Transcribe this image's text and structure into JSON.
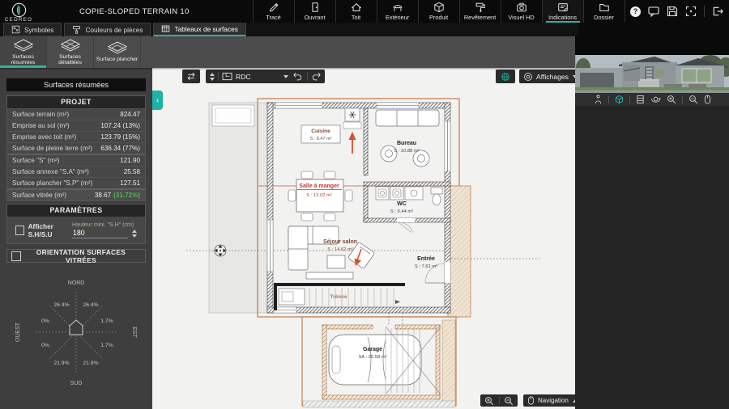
{
  "app": {
    "brand": "CEDREO",
    "title": "COPIE-SLOPED TERRAIN 10",
    "help_glyph": "?",
    "menu": [
      "Tracé",
      "Ouvrant",
      "Toit",
      "Extérieur",
      "Produit",
      "Revêtement",
      "Visuel HD",
      "Indications",
      "Dossier"
    ],
    "active_menu": "Indications"
  },
  "ribbon": {
    "tabs": [
      "Symboles",
      "Couleurs de pièces",
      "Tableaux de surfaces"
    ],
    "active_tab": "Tableaux de surfaces",
    "subtabs": [
      "Surfaces résumées",
      "Surfaces détaillées",
      "Surface plancher"
    ],
    "active_subtab": "Surfaces résumées"
  },
  "sidebar": {
    "title": "Surfaces résumées",
    "project": {
      "header": "PROJET",
      "rows": [
        {
          "label": "Surface terrain (m²)",
          "value": "824.47"
        },
        {
          "label": "Emprise au sol (m²)",
          "value": "107.24 (13%)"
        },
        {
          "label": "Emprise avec toit (m²)",
          "value": "123.79 (15%)"
        },
        {
          "label": "Surface de pleine terre (m²)",
          "value": "636.34 (77%)"
        },
        {
          "label": "Surface \"S\" (m²)",
          "value": "121.90"
        },
        {
          "label": "Surface annexe \"S.A\" (m²)",
          "value": "25.58"
        },
        {
          "label": "Surface plancher \"S.P\" (m²)",
          "value": "127.51"
        },
        {
          "label": "Surface vitrée (m²)",
          "value": "38.67",
          "percent": "(31.72%)"
        }
      ]
    },
    "parameters": {
      "header": "PARAMÈTRES",
      "checkbox_label": "Afficher S.H/S.U",
      "input_label": "Hauteur mini. \"S.H\" (cm)",
      "input_value": "180"
    },
    "orientation": {
      "header": "ORIENTATION SURFACES VITRÉES",
      "compass": {
        "north": "NORD",
        "south": "SUD",
        "east": "EST",
        "west": "OUEST",
        "nnw": "26.4%",
        "nne": "26.4%",
        "wnw": "0%",
        "ene": "1.7%",
        "wsw": "0%",
        "ese": "1.7%",
        "ssw": "21.9%",
        "sse": "21.9%"
      }
    }
  },
  "canvas": {
    "floor_dropdown": "RDC",
    "affichages_label": "Affichages",
    "navigation_label": "Navigation",
    "rooms": {
      "cuisine": {
        "name": "Cuisine",
        "area": "S : 8.47 m²"
      },
      "bureau": {
        "name": "Bureau",
        "area": "S : 10.88 m²"
      },
      "salle_a_manger": {
        "name": "Salle à manger",
        "area": "S : 13.02 m²"
      },
      "wc": {
        "name": "WC",
        "area": "S : 5.44 m²"
      },
      "sejour": {
        "name": "Séjour salon",
        "area": "S : 14.62 m²"
      },
      "entree": {
        "name": "Entrée",
        "area": "S : 7.61 m²"
      },
      "tremie": {
        "name": "Trémie"
      },
      "garage": {
        "name": "Garage",
        "area": "SA : 25.58 m²"
      }
    }
  },
  "colors": {
    "accent_teal": "#2bb3a0",
    "roof_orange": "#c5824f",
    "selected_room_red": "#c0392b",
    "vitree_percent_green": "#52b551"
  }
}
